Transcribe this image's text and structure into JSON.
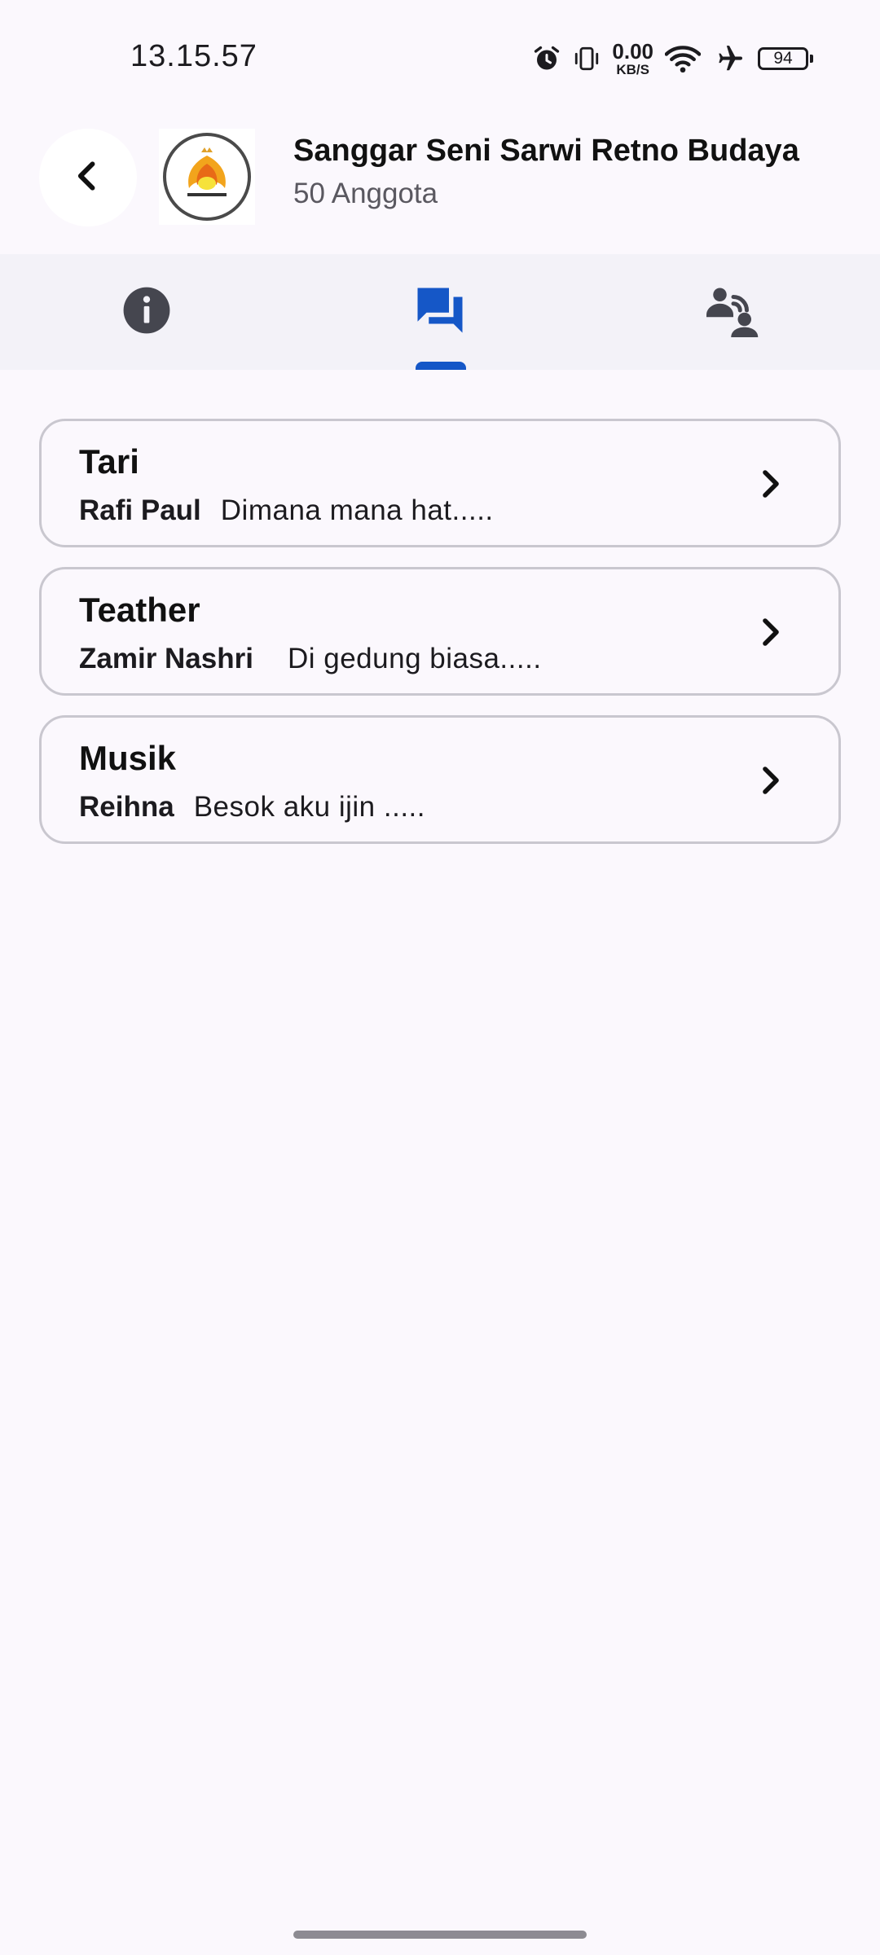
{
  "status_bar": {
    "time": "13.15.57",
    "net_speed_value": "0.00",
    "net_speed_unit": "KB/S",
    "battery": "94"
  },
  "header": {
    "title": "Sanggar Seni Sarwi Retno Budaya",
    "subtitle": "50 Anggota"
  },
  "tabs": [
    {
      "icon": "info-icon",
      "active": false
    },
    {
      "icon": "forum-icon",
      "active": true
    },
    {
      "icon": "members-icon",
      "active": false
    }
  ],
  "channels": [
    {
      "name": "Tari",
      "sender": "Rafi Paul",
      "message": "Dimana mana hat....."
    },
    {
      "name": "Teather",
      "sender": "Zamir Nashri",
      "message": "Di gedung biasa....."
    },
    {
      "name": "Musik",
      "sender": "Reihna",
      "message": "Besok aku ijin ....."
    }
  ],
  "colors": {
    "accent": "#1557c7",
    "background": "#fbf8fd",
    "tabbar": "#f3f2f8",
    "card_border": "#c9c7cf"
  }
}
